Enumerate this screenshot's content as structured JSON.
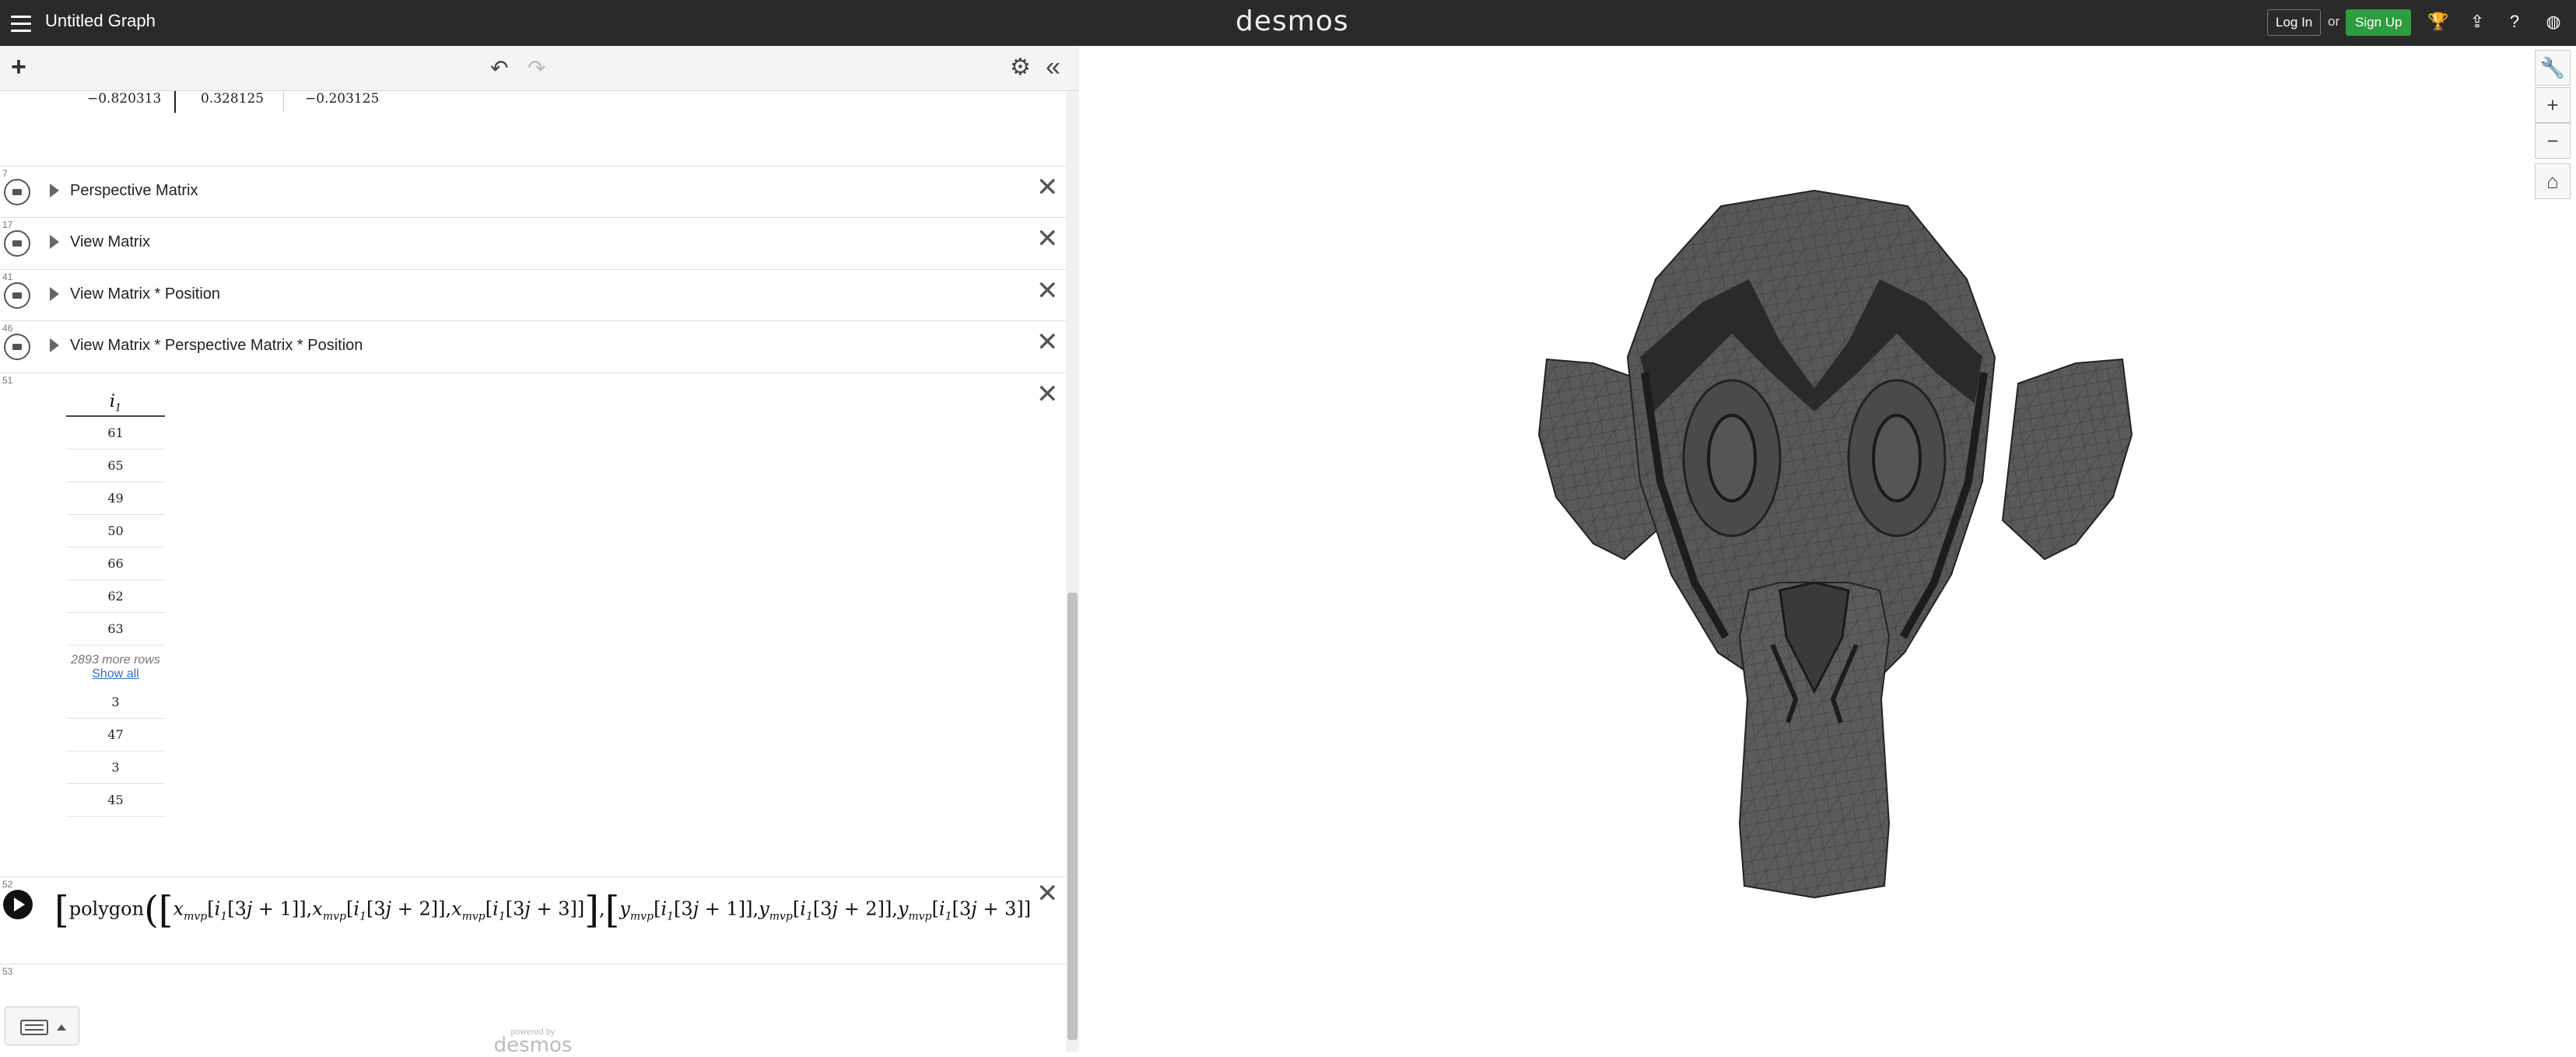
{
  "topbar": {
    "title": "Untitled Graph",
    "brand": "desmos",
    "login_label": "Log In",
    "or_text": "or",
    "signup_label": "Sign Up"
  },
  "expressions": {
    "matrix_row": [
      "−0.820313",
      "0.328125",
      "−0.203125"
    ],
    "folders": [
      {
        "num": "7",
        "label": "Perspective Matrix"
      },
      {
        "num": "17",
        "label": "View Matrix"
      },
      {
        "num": "41",
        "label": "View Matrix * Position"
      },
      {
        "num": "46",
        "label": "View Matrix * Perspective Matrix * Position"
      }
    ],
    "table": {
      "num": "51",
      "header": "i",
      "header_sub": "1",
      "top_rows": [
        "61",
        "65",
        "49",
        "50",
        "66",
        "62",
        "63"
      ],
      "more_rows": "2893 more rows",
      "show_all": "Show all",
      "bottom_rows": [
        "3",
        "47",
        "3",
        "45"
      ]
    },
    "formula": {
      "num": "52",
      "text": "polygon"
    },
    "empty_num": "53"
  },
  "footer": {
    "powered_by": "powered by",
    "brand": "desmos"
  },
  "colors": {
    "topbar_bg": "#2a2a2a",
    "signup_green": "#2f9c3f",
    "mesh_fill": "#555555"
  }
}
